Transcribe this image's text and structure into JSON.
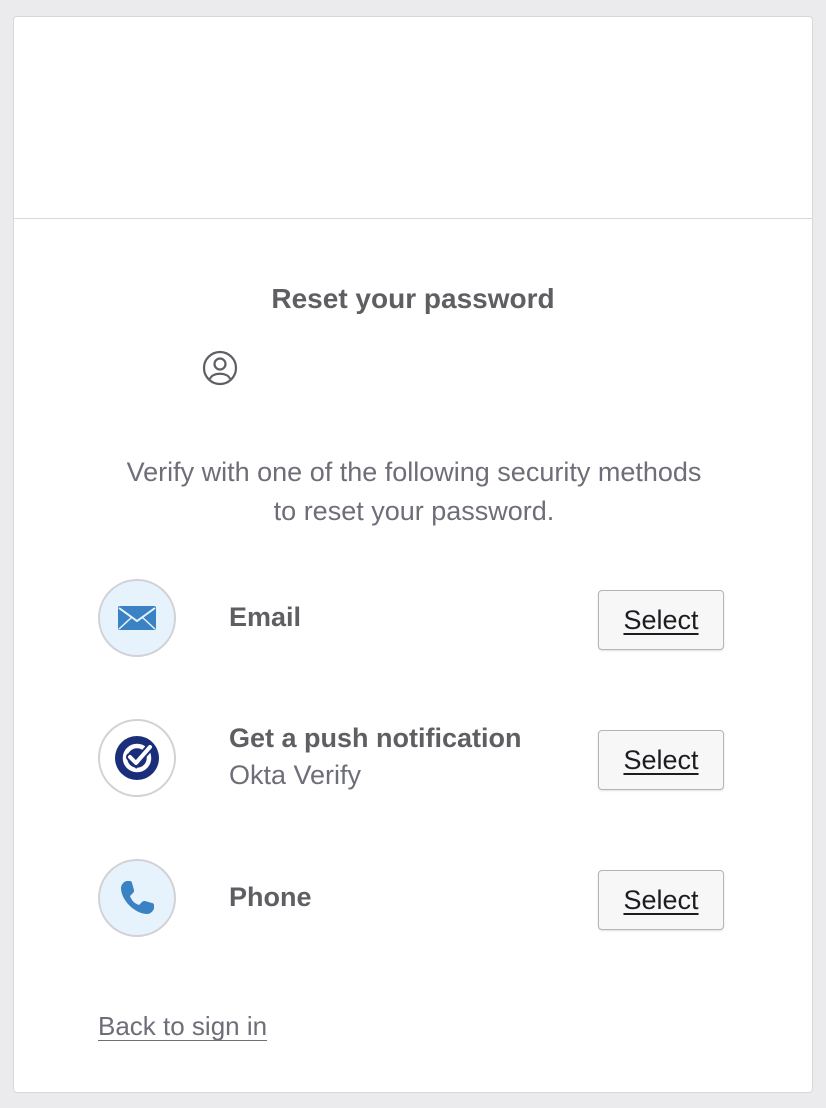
{
  "page": {
    "title": "Reset your password",
    "subtitle": "Verify with one of the following security methods to reset your password."
  },
  "methods": [
    {
      "label": "Email",
      "sublabel": "",
      "icon": "email-icon",
      "select_label": "Select"
    },
    {
      "label": "Get a push notification",
      "sublabel": "Okta Verify",
      "icon": "okta-verify-icon",
      "select_label": "Select"
    },
    {
      "label": "Phone",
      "sublabel": "",
      "icon": "phone-icon",
      "select_label": "Select"
    }
  ],
  "footer": {
    "back_link": "Back to sign in"
  },
  "colors": {
    "text_dark": "#5f5f63",
    "text_muted": "#6e6e78",
    "icon_blue_bg": "#e6f3fd",
    "icon_blue": "#3a82c4",
    "okta_navy": "#1a2e7a"
  }
}
